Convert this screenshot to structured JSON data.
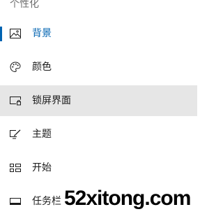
{
  "section": {
    "title": "个性化"
  },
  "nav": {
    "items": [
      {
        "label": "背景",
        "icon": "picture-icon",
        "state": "selected"
      },
      {
        "label": "颜色",
        "icon": "palette-icon",
        "state": "normal"
      },
      {
        "label": "锁屏界面",
        "icon": "lock-screen-icon",
        "state": "hover"
      },
      {
        "label": "主题",
        "icon": "theme-brush-icon",
        "state": "normal"
      },
      {
        "label": "开始",
        "icon": "start-tiles-icon",
        "state": "normal"
      },
      {
        "label": "任务栏",
        "icon": "taskbar-icon",
        "state": "normal"
      }
    ]
  },
  "watermark": {
    "text": "52xitong.com"
  },
  "colors": {
    "accent": "#0063b1",
    "hover_bg": "#e6e6e6",
    "text": "#1a1a1a",
    "header_text": "#6e6e6e"
  }
}
